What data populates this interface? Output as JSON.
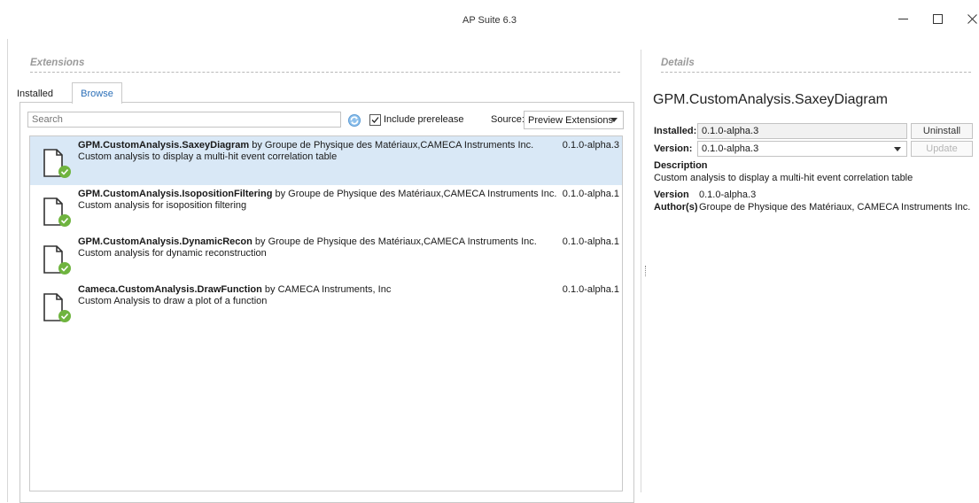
{
  "window": {
    "title": "AP Suite 6.3"
  },
  "extensions": {
    "section_title": "Extensions",
    "tabs": [
      {
        "label": "Installed",
        "active": false
      },
      {
        "label": "Browse",
        "active": true
      }
    ],
    "search": {
      "placeholder": "Search",
      "value": ""
    },
    "include_prerelease_label": "Include prerelease",
    "include_prerelease_checked": true,
    "source_label": "Source:",
    "source_value": "Preview Extensions",
    "packages": [
      {
        "name": "GPM.CustomAnalysis.SaxeyDiagram",
        "by": "by Groupe de Physique des Matériaux,CAMECA Instruments Inc.",
        "description": "Custom analysis to display a multi-hit event correlation table",
        "version": "0.1.0-alpha.3",
        "selected": true
      },
      {
        "name": "GPM.CustomAnalysis.IsopositionFiltering",
        "by": "by Groupe de Physique des Matériaux,CAMECA Instruments Inc.",
        "description": "Custom analysis for isoposition filtering",
        "version": "0.1.0-alpha.1",
        "selected": false
      },
      {
        "name": "GPM.CustomAnalysis.DynamicRecon",
        "by": "by Groupe de Physique des Matériaux,CAMECA Instruments Inc.",
        "description": "Custom analysis for dynamic reconstruction",
        "version": "0.1.0-alpha.1",
        "selected": false
      },
      {
        "name": "Cameca.CustomAnalysis.DrawFunction",
        "by": "by CAMECA Instruments, Inc",
        "description": "Custom Analysis to draw a plot of a function",
        "version": "0.1.0-alpha.1",
        "selected": false
      }
    ]
  },
  "details": {
    "section_title": "Details",
    "package_title": "GPM.CustomAnalysis.SaxeyDiagram",
    "installed_label": "Installed:",
    "installed_value": "0.1.0-alpha.3",
    "uninstall_label": "Uninstall",
    "version_label": "Version:",
    "version_value": "0.1.0-alpha.3",
    "update_label": "Update",
    "description_heading": "Description",
    "description_text": "Custom analysis to display a multi-hit event correlation table",
    "version_meta_label": "Version",
    "version_meta_value": "0.1.0-alpha.3",
    "authors_label": "Author(s)",
    "authors_value": "Groupe de Physique des Matériaux, CAMECA Instruments Inc."
  },
  "colors": {
    "selected_row": "#d9e8f6",
    "active_tab_text": "#2b6fb8",
    "badge_green": "#6fb43f"
  },
  "icons": [
    "refresh-icon",
    "package-file-icon",
    "installed-check-badge-icon",
    "minimize-icon",
    "maximize-icon",
    "close-icon",
    "chevron-down-icon"
  ]
}
